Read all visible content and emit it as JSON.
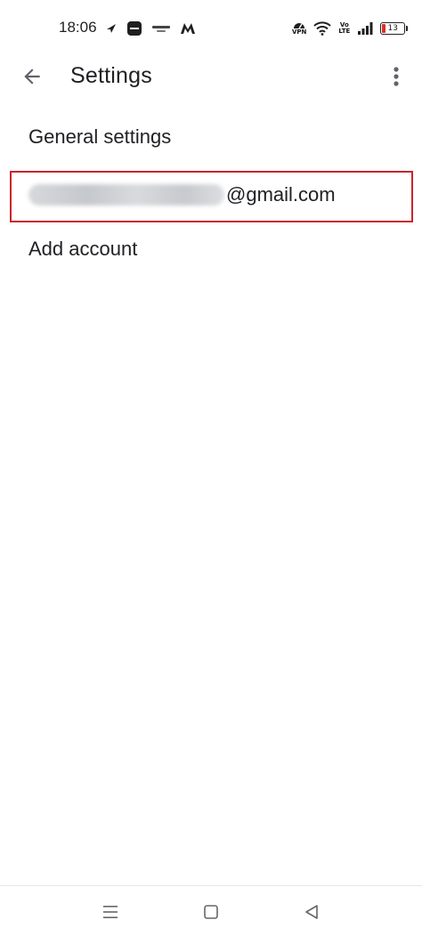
{
  "status_bar": {
    "time": "18:06",
    "left_icons": [
      "navigation-arrow-icon",
      "app-notification-icon",
      "app-notification-icon",
      "myntra-m-icon"
    ],
    "right_icons": [
      "vpn-icon",
      "wifi-icon",
      "volte-icon",
      "signal-icon",
      "battery-icon"
    ],
    "vpn_label": "VPN",
    "volte_top": "Vo",
    "volte_bottom": "LTE",
    "battery_level": "13",
    "battery_color": "#d93025"
  },
  "app_bar": {
    "title": "Settings",
    "back_icon": "arrow-left-icon",
    "overflow_icon": "more-vert-icon"
  },
  "settings_list": {
    "general_settings": "General settings",
    "account_email_domain": "@gmail.com",
    "add_account": "Add account"
  },
  "highlight": {
    "color": "#c9252c"
  },
  "nav_bar": {
    "recents_icon": "menu-lines-icon",
    "home_icon": "square-icon",
    "back_icon": "triangle-back-icon"
  }
}
